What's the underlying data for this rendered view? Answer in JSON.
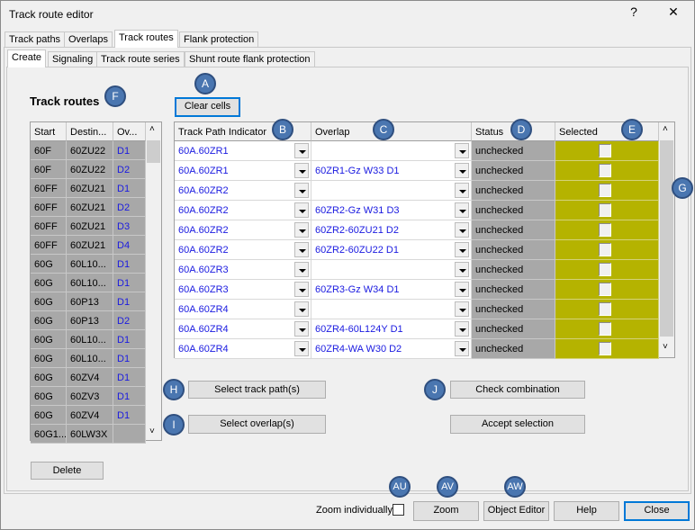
{
  "window": {
    "title": "Track route editor",
    "help_label": "?",
    "close_label": "✕"
  },
  "tabs": [
    "Track paths",
    "Overlaps",
    "Track routes",
    "Flank protection"
  ],
  "subtabs": [
    "Create",
    "Signaling",
    "Track route series",
    "Shunt route flank protection"
  ],
  "track_routes": {
    "heading": "Track routes",
    "columns": [
      "Start",
      "Destin...",
      "Ov..."
    ],
    "rows": [
      [
        "60F",
        "60ZU22",
        "D1"
      ],
      [
        "60F",
        "60ZU22",
        "D2"
      ],
      [
        "60FF",
        "60ZU21",
        "D1"
      ],
      [
        "60FF",
        "60ZU21",
        "D2"
      ],
      [
        "60FF",
        "60ZU21",
        "D3"
      ],
      [
        "60FF",
        "60ZU21",
        "D4"
      ],
      [
        "60G",
        "60L10...",
        "D1"
      ],
      [
        "60G",
        "60L10...",
        "D1"
      ],
      [
        "60G",
        "60P13",
        "D1"
      ],
      [
        "60G",
        "60P13",
        "D2"
      ],
      [
        "60G",
        "60L10...",
        "D1"
      ],
      [
        "60G",
        "60L10...",
        "D1"
      ],
      [
        "60G",
        "60ZV4",
        "D1"
      ],
      [
        "60G",
        "60ZV3",
        "D1"
      ],
      [
        "60G",
        "60ZV4",
        "D1"
      ],
      [
        "60G1...",
        "60LW3X",
        ""
      ]
    ]
  },
  "buttons": {
    "clear_cells": "Clear cells",
    "delete": "Delete",
    "select_track_path": "Select track path(s)",
    "select_overlap": "Select overlap(s)",
    "check_combination": "Check combination",
    "accept_selection": "Accept selection",
    "zoom": "Zoom",
    "object_editor": "Object Editor",
    "help": "Help",
    "close": "Close"
  },
  "zoom_individually": {
    "label": "Zoom individually",
    "checked": false
  },
  "combo_grid": {
    "columns": [
      "Track Path Indicator",
      "Overlap",
      "Status",
      "Selected"
    ],
    "rows": [
      [
        "60A.60ZR1",
        "",
        "unchecked",
        false
      ],
      [
        "60A.60ZR1",
        "60ZR1-Gz W33 D1",
        "unchecked",
        false
      ],
      [
        "60A.60ZR2",
        "",
        "unchecked",
        false
      ],
      [
        "60A.60ZR2",
        "60ZR2-Gz W31 D3",
        "unchecked",
        false
      ],
      [
        "60A.60ZR2",
        "60ZR2-60ZU21 D2",
        "unchecked",
        false
      ],
      [
        "60A.60ZR2",
        "60ZR2-60ZU22 D1",
        "unchecked",
        false
      ],
      [
        "60A.60ZR3",
        "",
        "unchecked",
        false
      ],
      [
        "60A.60ZR3",
        "60ZR3-Gz W34 D1",
        "unchecked",
        false
      ],
      [
        "60A.60ZR4",
        "",
        "unchecked",
        false
      ],
      [
        "60A.60ZR4",
        "60ZR4-60L124Y D1",
        "unchecked",
        false
      ],
      [
        "60A.60ZR4",
        "60ZR4-WA W30 D2",
        "unchecked",
        false
      ]
    ]
  },
  "badges": {
    "a": "A",
    "b": "B",
    "c": "C",
    "d": "D",
    "e": "E",
    "f": "F",
    "g": "G",
    "h": "H",
    "i": "I",
    "j": "J",
    "au": "AU",
    "av": "AV",
    "aw": "AW"
  },
  "colors": {
    "selected_bg": "#b5b300",
    "readonly_bg": "#a8a8a8",
    "link_text": "#1a1ae0",
    "badge": "#4a76b0"
  }
}
